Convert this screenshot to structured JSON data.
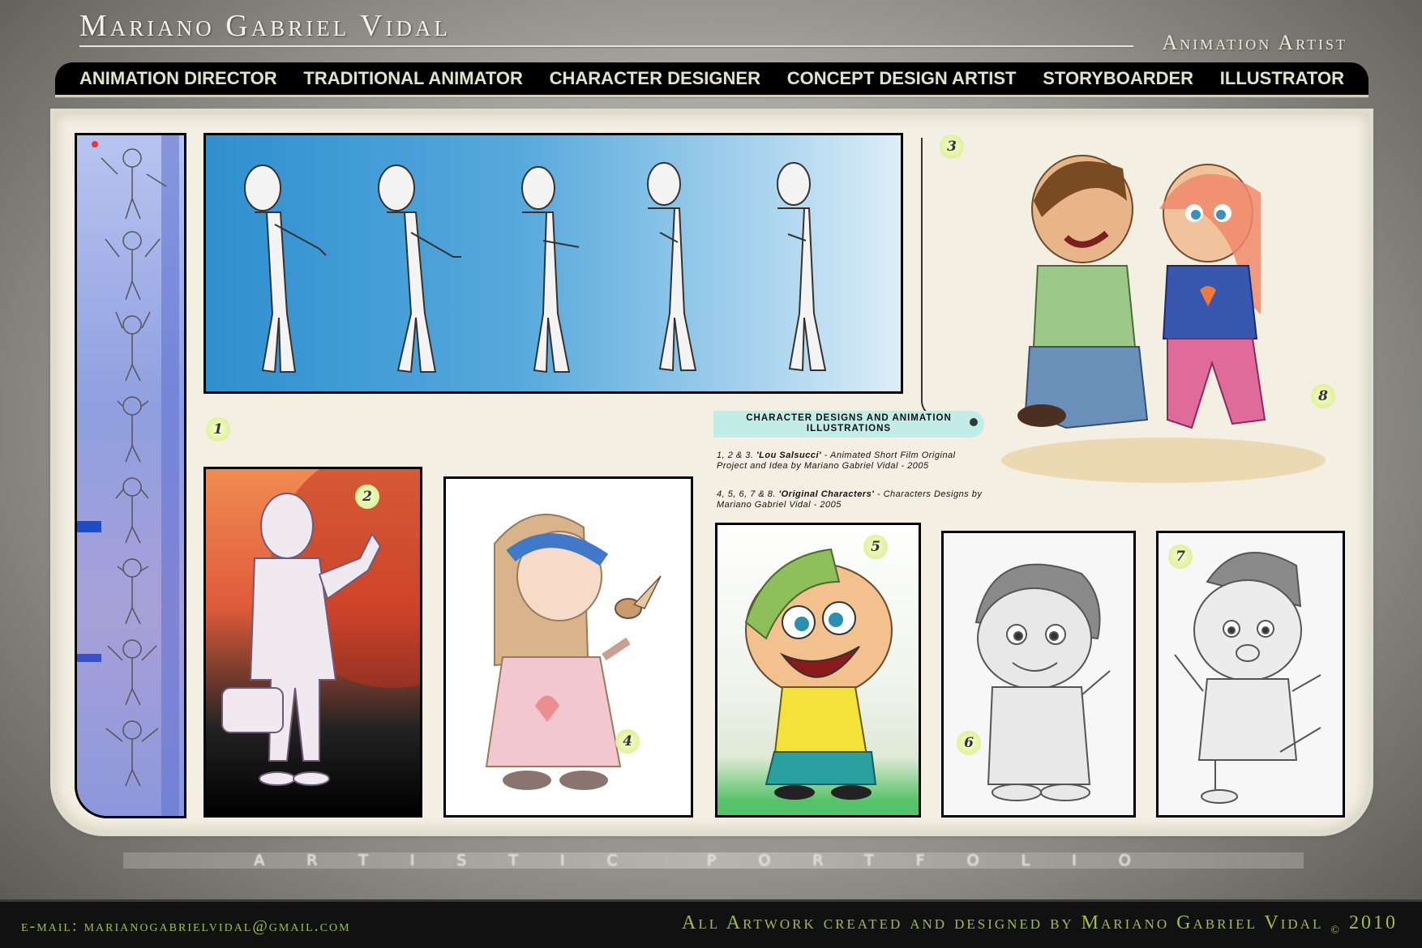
{
  "header": {
    "title": "Mariano Gabriel Vidal",
    "subtitle": "Animation Artist"
  },
  "nav": {
    "items": [
      {
        "label": "ANIMATION DIRECTOR"
      },
      {
        "label": "TRADITIONAL ANIMATOR"
      },
      {
        "label": "CHARACTER DESIGNER"
      },
      {
        "label": "CONCEPT DESIGN ARTIST"
      },
      {
        "label": "STORYBOARDER"
      },
      {
        "label": "ILLUSTRATOR"
      }
    ]
  },
  "gallery": {
    "badges": [
      "1",
      "2",
      "3",
      "4",
      "5",
      "6",
      "7",
      "8"
    ]
  },
  "caption": {
    "heading": "CHARACTER DESIGNS AND ANIMATION ILLUSTRATIONS",
    "entry1_numbers": "1, 2 & 3.",
    "entry1_title": "'Lou Salsucci'",
    "entry1_text": "- Animated Short Film Original Project and Idea by Mariano Gabriel Vidal - 2005",
    "entry2_numbers": "4, 5, 6, 7 & 8.",
    "entry2_title": "'Original Characters'",
    "entry2_text": "- Characters Designs by Mariano Gabriel Vidal - 2005"
  },
  "portfolio_strip": "ARTISTIC PORTFOLIO",
  "footer": {
    "email": "e-mail: marianogabrielvidal@gmail.com",
    "credit": "All Artwork created and designed by Mariano Gabriel Vidal",
    "copyright_symbol": "©",
    "year": "2010",
    "accent_color": "#9fbd4a"
  },
  "colors": {
    "nav_background": "#000000",
    "panel_background": "#f3efe3",
    "badge_green": "#dff29a",
    "banner_blue": "#2f8fcf"
  }
}
